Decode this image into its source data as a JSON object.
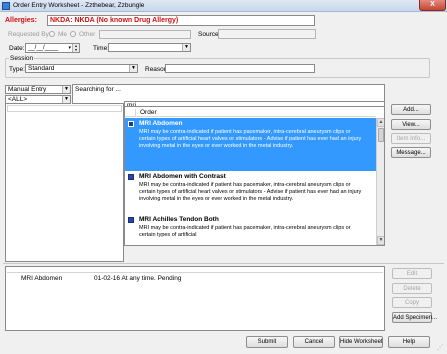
{
  "window": {
    "title": "Order Entry Worksheet - Zzthebear, Zzbungle",
    "close_glyph": "X"
  },
  "allergies": {
    "label": "Allergies:",
    "value": "NKDA: NKDA (No known Drug Allergy)"
  },
  "requested_by": {
    "label": "Requested By:",
    "options": [
      "Me",
      "Other"
    ]
  },
  "source": {
    "label": "Source:",
    "value": ""
  },
  "date": {
    "label": "Date:",
    "value": "__/__/____"
  },
  "time": {
    "label": "Time:",
    "value": ""
  },
  "session": {
    "group_label": "Session",
    "type_label": "Type:",
    "type_value": "Standard",
    "reason_label": "Reason:",
    "reason_value": ""
  },
  "entry_mode": {
    "value": "Manual Entry"
  },
  "category_filter": {
    "value": "<ALL>"
  },
  "searching": {
    "label": "Searching for ..."
  },
  "search_input": {
    "value": "mri"
  },
  "order_list": {
    "header": "Order",
    "items": [
      {
        "title": "MRI Abdomen",
        "description": "MRI may be contra-indicated if patient has pacemaker, intra-cerebral aneurysm clips or certain types of artificial heart valves or stimulators - Advise if patient has ever had an injury involving metal in the eyes or ever worked in the metal industry.",
        "selected": true
      },
      {
        "title": "MRI Abdomen with Contrast",
        "description": "MRI may be contra-indicated if patient has pacemaker, intra-cerebral aneurysm clips or certain types of artificial heart valves or stimulators - Advise if patient has ever had an injury involving metal in the eyes or ever worked in the metal industry.",
        "selected": false
      },
      {
        "title": "MRI Achilles Tendon Both",
        "description": "MRI may be contra-indicated if patient has pacemaker, intra-cerebral aneurysm clips or certain types of artificial",
        "selected": false
      }
    ]
  },
  "side_buttons": {
    "add": "Add...",
    "view": "View...",
    "item_info": "Item Info...",
    "message": "Message..."
  },
  "worksheet": {
    "rows": [
      {
        "order": "MRI Abdomen",
        "details": "01-02-16 At any time. Pending"
      }
    ]
  },
  "worksheet_buttons": {
    "edit": "Edit",
    "delete": "Delete",
    "copy": "Copy",
    "add_specimen": "Add Specimen..."
  },
  "footer_buttons": {
    "submit": "Submit",
    "cancel": "Cancel",
    "hide_worksheet": "Hide Worksheet",
    "help": "Help"
  },
  "colors": {
    "allergy_red": "#d01010",
    "selection_blue": "#3399ff"
  }
}
